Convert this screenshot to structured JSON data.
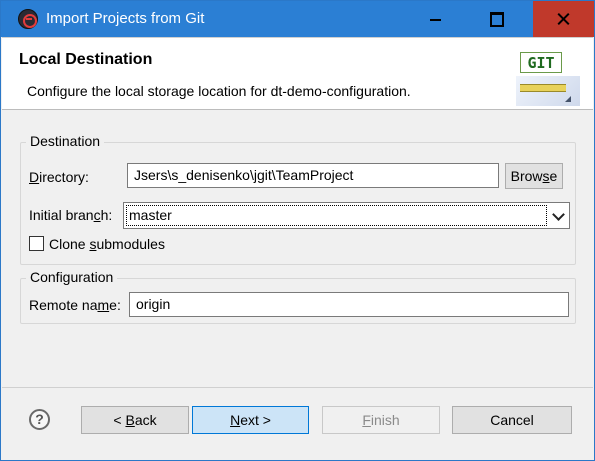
{
  "window": {
    "title": "Import Projects from Git"
  },
  "header": {
    "title": "Local Destination",
    "description": "Configure the local storage location for dt-demo-configuration.",
    "logo_text": "GIT"
  },
  "destination": {
    "legend": "Destination",
    "directory_label_mnemonic": "D",
    "directory_label_rest": "irectory:",
    "directory_value": "Jsers\\s_denisenko\\jgit\\TeamProject",
    "browse_pre": "Brow",
    "browse_mnemonic": "s",
    "browse_post": "e",
    "branch_label_pre": "Initial bran",
    "branch_label_mnemonic": "c",
    "branch_label_post": "h:",
    "branch_value": "master",
    "clone_pre": "Clone ",
    "clone_mnemonic": "s",
    "clone_post": "ubmodules",
    "clone_checked": false
  },
  "configuration": {
    "legend": "Configuration",
    "remote_label_pre": "Remote na",
    "remote_label_mnemonic": "m",
    "remote_label_post": "e:",
    "remote_value": "origin"
  },
  "footer": {
    "help_symbol": "?",
    "back_pre": "< ",
    "back_mnemonic": "B",
    "back_post": "ack",
    "next_mnemonic": "N",
    "next_post": "ext >",
    "finish_mnemonic": "F",
    "finish_post": "inish",
    "cancel_label": "Cancel"
  },
  "colors": {
    "titlebar": "#2b7fd4",
    "close_button": "#c0392b",
    "default_button": "#cce4f7",
    "default_button_border": "#0078d7"
  },
  "icons": {
    "app": "eclipse-icon",
    "minimize": "minimize-icon",
    "maximize": "maximize-icon",
    "close": "close-icon",
    "help": "help-icon",
    "dropdown": "chevron-down-icon"
  }
}
